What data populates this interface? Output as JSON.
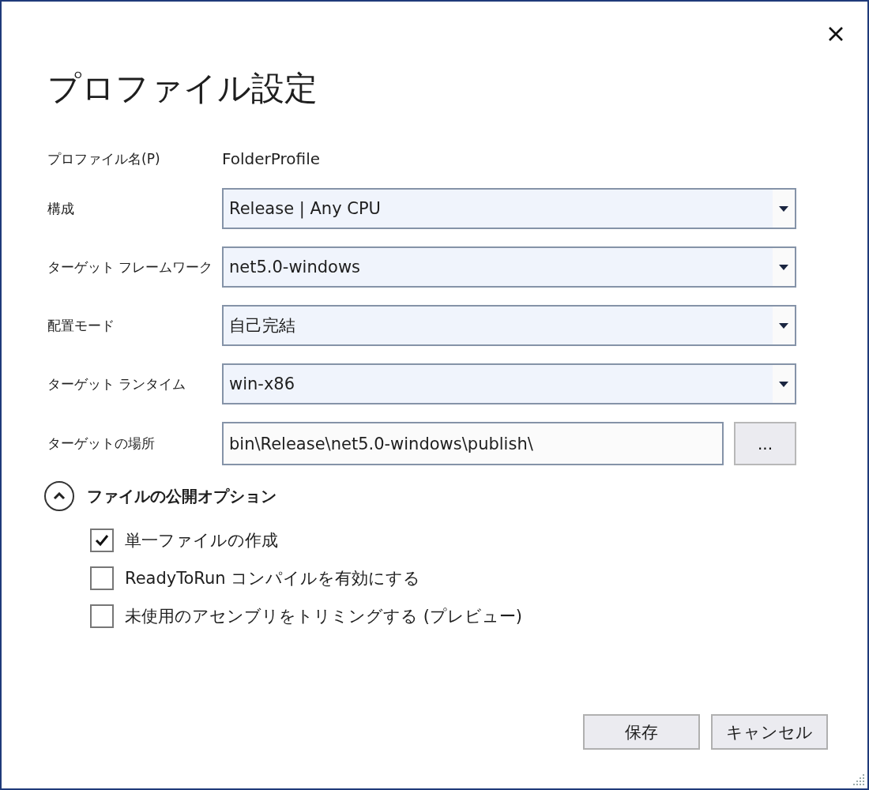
{
  "window": {
    "title": "プロファイル設定"
  },
  "fields": [
    {
      "kind": "static",
      "label": "プロファイル名(P)",
      "value": "FolderProfile"
    },
    {
      "kind": "dropdown",
      "label": "構成",
      "value": "Release | Any CPU"
    },
    {
      "kind": "dropdown",
      "label": "ターゲット フレームワーク",
      "value": "net5.0-windows"
    },
    {
      "kind": "dropdown",
      "label": "配置モード",
      "value": "自己完結"
    },
    {
      "kind": "dropdown",
      "label": "ターゲット ランタイム",
      "value": "win-x86"
    },
    {
      "kind": "path",
      "label": "ターゲットの場所",
      "value": "bin\\Release\\net5.0-windows\\publish\\",
      "browse": "..."
    }
  ],
  "options": {
    "label": "ファイルの公開オプション",
    "expanded": true,
    "items": [
      {
        "label": "単一ファイルの作成",
        "checked": true
      },
      {
        "label": "ReadyToRun コンパイルを有効にする",
        "checked": false
      },
      {
        "label": "未使用のアセンブリをトリミングする (プレビュー)",
        "checked": false
      }
    ]
  },
  "buttons": [
    "保存",
    "キャンセル"
  ]
}
